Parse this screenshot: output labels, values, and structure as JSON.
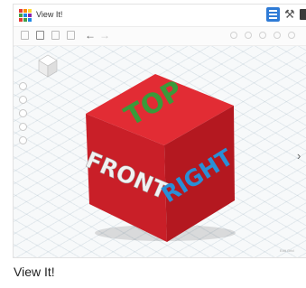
{
  "app": {
    "title": "View It!"
  },
  "cube_faces": {
    "top": "TOP",
    "front": "FRONT",
    "right": "RIGHT"
  },
  "viewport": {
    "watermark": "Edit Grid"
  },
  "caption": "View It!",
  "colors": {
    "cube_red": "#d4202a",
    "top_text": "#3a9a3a",
    "front_text": "#f2f2f2",
    "right_text": "#2a8fd6",
    "accent_blue": "#2f7bd6",
    "logo": [
      "#e53935",
      "#fb8c00",
      "#fdd835",
      "#43a047",
      "#1e88e5",
      "#8e24aa",
      "#e53935",
      "#43a047",
      "#1e88e5"
    ]
  },
  "icons": [
    "tinkercad-logo-icon",
    "grid-view-icon",
    "hammer-icon",
    "panel-icon",
    "copy-icon",
    "paste-icon",
    "duplicate-icon",
    "delete-icon",
    "undo-icon",
    "redo-icon",
    "home-view-icon",
    "zoom-in-icon",
    "zoom-out-icon",
    "orthographic-icon",
    "view-cube-icon",
    "chevron-right-icon"
  ]
}
